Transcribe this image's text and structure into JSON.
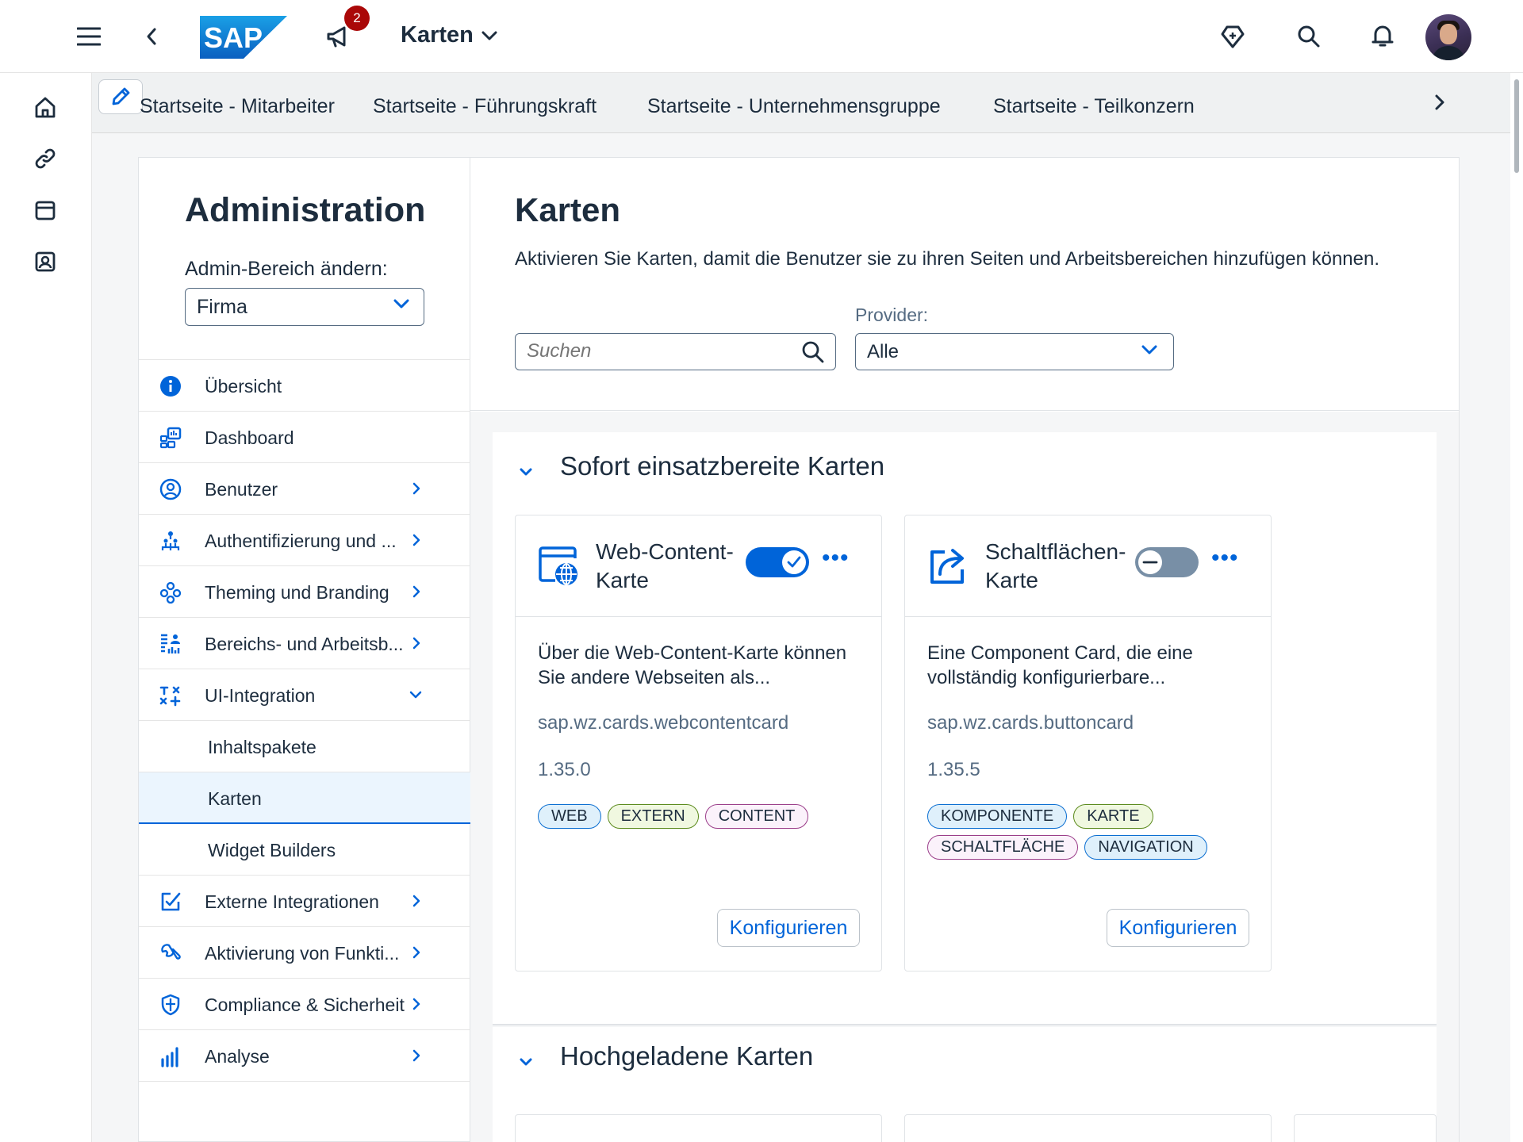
{
  "shell": {
    "app_title": "Karten",
    "notification_count": "2",
    "logo_text": "SAP",
    "colors": {
      "brand": "#0a6ed1",
      "accent": "#0064d9",
      "badge": "#aa0808"
    }
  },
  "tabs": [
    {
      "label": "Startseite - Mitarbeiter"
    },
    {
      "label": "Startseite - Führungskraft"
    },
    {
      "label": "Startseite - Unternehmensgruppe"
    },
    {
      "label": "Startseite - Teilkonzern"
    }
  ],
  "nav": {
    "title": "Administration",
    "area_label": "Admin-Bereich ändern:",
    "area_value": "Firma",
    "items": [
      {
        "label": "Übersicht",
        "icon": "info-icon"
      },
      {
        "label": "Dashboard",
        "icon": "dashboard-icon"
      },
      {
        "label": "Benutzer",
        "icon": "user-icon"
      },
      {
        "label": "Authentifizierung und ...",
        "icon": "hierarchy-icon"
      },
      {
        "label": "Theming und Branding",
        "icon": "theme-icon"
      },
      {
        "label": "Bereichs- und Arbeitsb...",
        "icon": "workspace-icon"
      },
      {
        "label": "UI-Integration",
        "icon": "ui-integration-icon"
      },
      {
        "label": "Inhaltspakete"
      },
      {
        "label": "Karten"
      },
      {
        "label": "Widget Builders"
      },
      {
        "label": "Externe Integrationen",
        "icon": "external-icon"
      },
      {
        "label": "Aktivierung von Funkti...",
        "icon": "wrench-icon"
      },
      {
        "label": "Compliance & Sicherheit",
        "icon": "shield-icon"
      },
      {
        "label": "Analyse",
        "icon": "analytics-icon"
      }
    ]
  },
  "main": {
    "title": "Karten",
    "description": "Aktivieren Sie Karten, damit die Benutzer sie zu ihren Seiten und Arbeitsbereichen hinzufügen können.",
    "search_placeholder": "Suchen",
    "provider_label": "Provider:",
    "provider_value": "Alle"
  },
  "sections": [
    {
      "title": "Sofort einsatzbereite Karten",
      "cards": [
        {
          "title": "Web-Content-Karte",
          "enabled": true,
          "description": "Über die Web-Content-Karte können Sie andere Webseiten als...",
          "id": "sap.wz.cards.webcontentcard",
          "version": "1.35.0",
          "tags": [
            "WEB",
            "EXTERN",
            "CONTENT"
          ],
          "button": "Konfigurieren"
        },
        {
          "title": "Schaltflächen-Karte",
          "enabled": false,
          "description": "Eine Component Card, die eine vollständig konfigurierbare...",
          "id": "sap.wz.cards.buttoncard",
          "version": "1.35.5",
          "tags": [
            "KOMPONENTE",
            "KARTE",
            "SCHALTFLÄCHE",
            "NAVIGATION"
          ],
          "button": "Konfigurieren"
        }
      ]
    },
    {
      "title": "Hochgeladene Karten"
    }
  ]
}
